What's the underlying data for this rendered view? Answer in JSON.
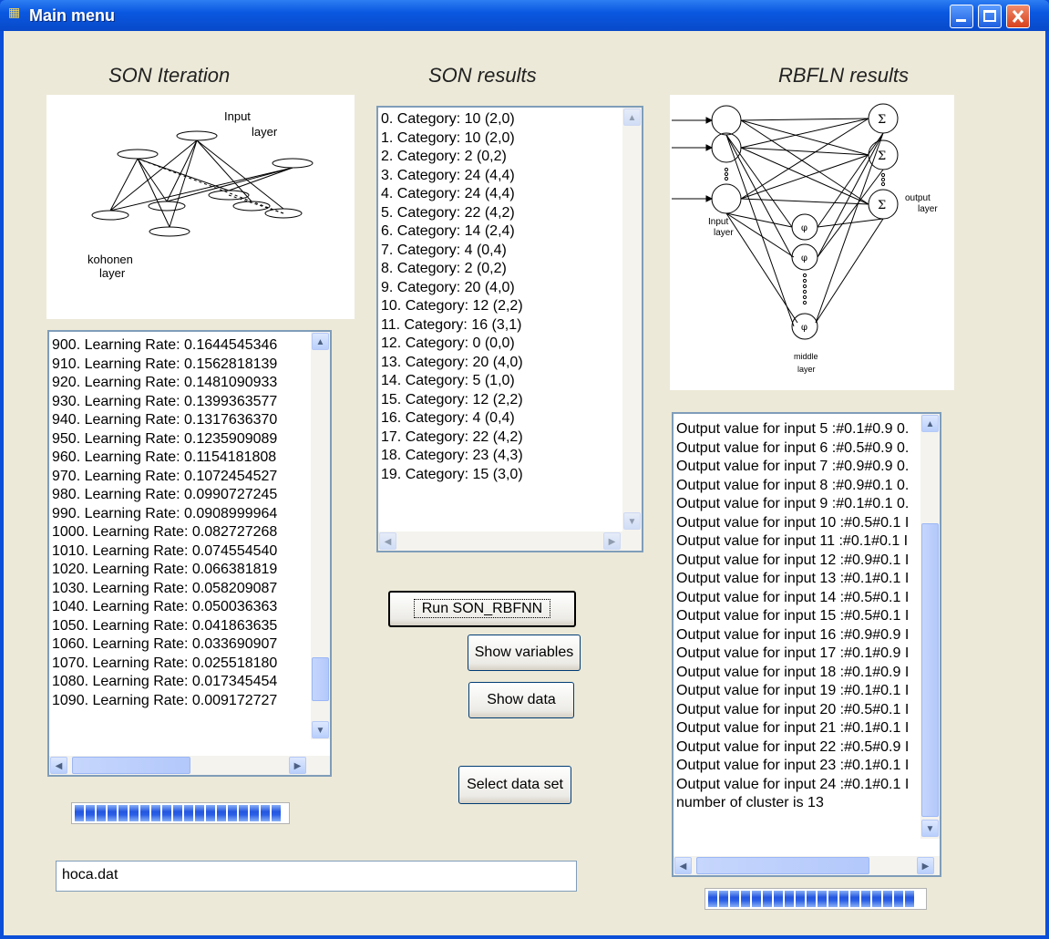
{
  "window": {
    "title": "Main menu",
    "icon": "app-icon"
  },
  "headings": {
    "son_iteration": "SON Iteration",
    "son_results": "SON results",
    "rbfln_results": "RBFLN results"
  },
  "kohonen_image": {
    "input_label_1": "Input",
    "input_label_2": "layer",
    "kohonen_label_1": "kohonen",
    "kohonen_label_2": "layer"
  },
  "rbf_image": {
    "input_label_1": "Input",
    "input_label_2": "layer",
    "output_label_1": "output",
    "output_label_2": "layer",
    "middle_label_1": "middle",
    "middle_label_2": "layer",
    "sigma": "Σ",
    "phi": "φ"
  },
  "iteration_list": [
    "900.  Learning Rate: 0.1644545346",
    "910.  Learning Rate: 0.1562818139",
    "920.  Learning Rate: 0.1481090933",
    "930.  Learning Rate: 0.1399363577",
    "940.  Learning Rate: 0.1317636370",
    "950.  Learning Rate: 0.1235909089",
    "960.  Learning Rate: 0.1154181808",
    "970.  Learning Rate: 0.1072454527",
    "980.  Learning Rate: 0.0990727245",
    "990.  Learning Rate: 0.0908999964",
    "1000.  Learning Rate: 0.082727268",
    "1010.  Learning Rate: 0.074554540",
    "1020.  Learning Rate: 0.066381819",
    "1030.  Learning Rate: 0.058209087",
    "1040.  Learning Rate: 0.050036363",
    "1050.  Learning Rate: 0.041863635",
    "1060.  Learning Rate: 0.033690907",
    "1070.  Learning Rate: 0.025518180",
    "1080.  Learning Rate: 0.017345454",
    "1090.  Learning Rate: 0.009172727"
  ],
  "son_results_list": [
    "0.  Category: 10  (2,0)",
    "1.  Category: 10  (2,0)",
    "2.  Category: 2  (0,2)",
    "3.  Category: 24  (4,4)",
    "4.  Category: 24  (4,4)",
    "5.  Category: 22  (4,2)",
    "6.  Category: 14  (2,4)",
    "7.  Category: 4  (0,4)",
    "8.  Category: 2  (0,2)",
    "9.  Category: 20  (4,0)",
    "10.  Category: 12  (2,2)",
    "11.  Category: 16  (3,1)",
    "12.  Category: 0  (0,0)",
    "13.  Category: 20  (4,0)",
    "14.  Category: 5  (1,0)",
    "15.  Category: 12  (2,2)",
    "16.  Category: 4  (0,4)",
    "17.  Category: 22  (4,2)",
    "18.  Category: 23  (4,3)",
    "19.  Category: 15  (3,0)"
  ],
  "rbfln_list": [
    "Output value for input 5 :#0.1#0.9  0.",
    "Output value for input 6 :#0.5#0.9  0.",
    "Output value for input 7 :#0.9#0.9  0.",
    "Output value for input 8 :#0.9#0.1  0.",
    "Output value for input 9 :#0.1#0.1  0.",
    "Output value for input 10 :#0.5#0.1  I",
    "Output value for input 11 :#0.1#0.1  I",
    "Output value for input 12 :#0.9#0.1  I",
    "Output value for input 13 :#0.1#0.1  I",
    "Output value for input 14 :#0.5#0.1  I",
    "Output value for input 15 :#0.5#0.1  I",
    "Output value for input 16 :#0.9#0.9  I",
    "Output value for input 17 :#0.1#0.9  I",
    "Output value for input 18 :#0.1#0.9  I",
    "Output value for input 19 :#0.1#0.1  I",
    "Output value for input 20 :#0.5#0.1  I",
    "Output value for input 21 :#0.1#0.1  I",
    "Output value for input 22 :#0.5#0.9  I",
    "Output value for input 23 :#0.1#0.1  I",
    "Output value for input 24 :#0.1#0.1  I",
    "number of cluster is 13"
  ],
  "buttons": {
    "run": "Run SON_RBFNN",
    "show_variables": "Show variables",
    "show_data": "Show data",
    "select_data_set": "Select data set"
  },
  "filename_field": {
    "value": "hoca.dat"
  },
  "progress": {
    "left_fraction": 1.0,
    "right_fraction": 1.0
  },
  "colors": {
    "title_bar": "#0a58e0",
    "progress_fill": "#2456e0",
    "window_bg": "#ece9d8"
  }
}
